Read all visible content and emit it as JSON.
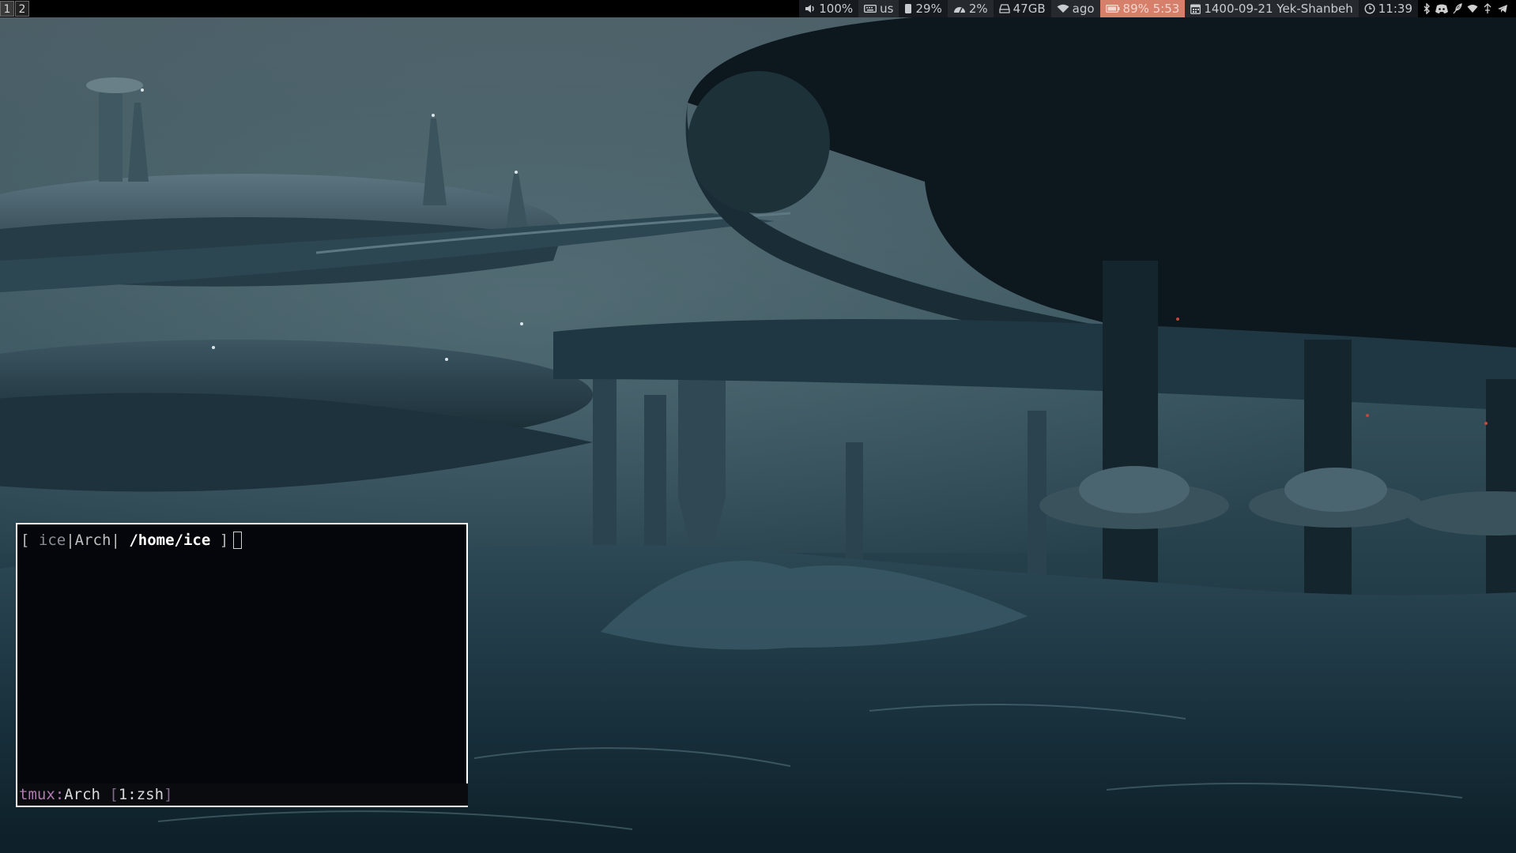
{
  "workspaces": [
    {
      "label": "1",
      "focused": true
    },
    {
      "label": "2",
      "focused": false
    }
  ],
  "status": {
    "volume": {
      "icon": "speaker-icon",
      "value": "100%"
    },
    "keyboard": {
      "icon": "keyboard-icon",
      "value": "us"
    },
    "memory": {
      "icon": "memory-icon",
      "value": "29%"
    },
    "cpu": {
      "icon": "gauge-icon",
      "value": "2%"
    },
    "disk": {
      "icon": "disk-icon",
      "value": "47GB"
    },
    "wifi": {
      "icon": "wifi-icon",
      "value": "ago"
    },
    "battery": {
      "icon": "battery-icon",
      "value": "89% 5:53",
      "color": "#d67f6a"
    },
    "date": {
      "icon": "calendar-icon",
      "value": "1400-09-21 Yek-Shanbeh"
    },
    "time": {
      "icon": "clock-icon",
      "value": "11:39"
    }
  },
  "tray": [
    "bluetooth-icon",
    "discord-icon",
    "feather-icon",
    "wifi-tray-icon",
    "network-manager-icon",
    "telegram-icon"
  ],
  "terminal": {
    "prompt": {
      "open": "[ ",
      "user": "ice",
      "sep1": "|",
      "host": "Arch",
      "sep2": "| ",
      "path": "/home/ice",
      "close": " ]"
    },
    "tmux": {
      "label": "tmux:",
      "session": "Arch",
      "window_open": " [",
      "window": "1:zsh",
      "window_close": "]"
    }
  },
  "colors": {
    "bar_bg": "#000000",
    "terminal_bg": "#04060b",
    "terminal_border": "#ffffff",
    "tmux_label": "#b07ab0"
  }
}
